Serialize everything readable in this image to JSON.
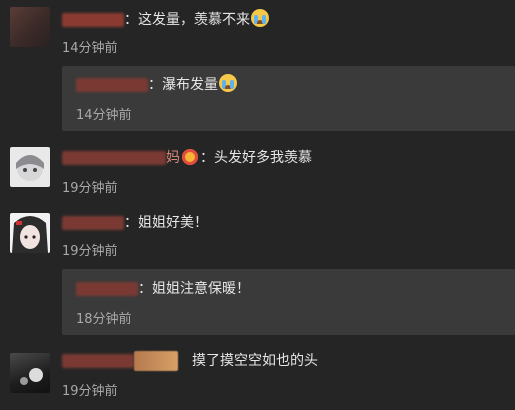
{
  "comments": [
    {
      "text": "：这发量，羡慕不来",
      "time": "14分钟前",
      "reply": {
        "text": "：瀑布发量",
        "time": "14分钟前"
      }
    },
    {
      "text": "：头发好多我羡慕",
      "name_tail": "妈",
      "time": "19分钟前"
    },
    {
      "text": "：姐姐好美！",
      "time": "19分钟前",
      "reply": {
        "text": "：姐姐注意保暖！",
        "time": "18分钟前"
      }
    },
    {
      "text": "摸了摸空空如也的头",
      "time": "19分钟前"
    }
  ],
  "icons": {
    "crying_emoji": "loudly-crying-face-icon",
    "vip_badge": "vip-badge-icon",
    "sticker": "sticker-image-icon"
  },
  "colors": {
    "background": "#252526",
    "reply_background": "#3a3a3a",
    "username": "#d98a7a",
    "timestamp": "#a9a9a9",
    "text": "#e6e6e6"
  }
}
